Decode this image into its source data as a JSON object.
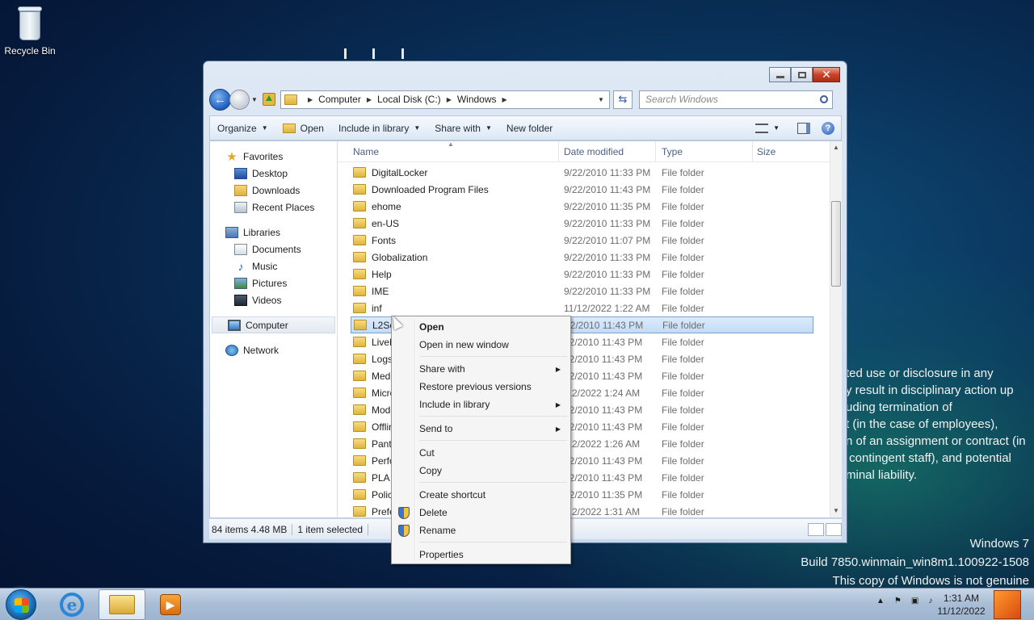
{
  "desktop": {
    "recycle_bin_label": "Recycle Bin",
    "legal_text": "ted use or disclosure in any\ny result in disciplinary action up\nuding termination of\nt (in the case of employees),\nn of an assignment or contract (in\n contingent staff), and potential\nminal liability.",
    "build_lines": [
      "Windows 7",
      "Build 7850.winmain_win8m1.100922-1508",
      "This copy of Windows is not genuine"
    ]
  },
  "window": {
    "address": [
      "Computer",
      "Local Disk (C:)",
      "Windows"
    ],
    "search_placeholder": "Search Windows",
    "toolbar": {
      "organize": "Organize",
      "open": "Open",
      "include_in_library": "Include in library",
      "share_with": "Share with",
      "new_folder": "New folder"
    },
    "nav": {
      "favorites": "Favorites",
      "favorites_items": [
        "Desktop",
        "Downloads",
        "Recent Places"
      ],
      "libraries": "Libraries",
      "library_items": [
        "Documents",
        "Music",
        "Pictures",
        "Videos"
      ],
      "computer": "Computer",
      "network": "Network"
    },
    "columns": [
      "Name",
      "Date modified",
      "Type",
      "Size"
    ],
    "files": [
      {
        "name": "DigitalLocker",
        "date": "9/22/2010 11:33 PM",
        "type": "File folder"
      },
      {
        "name": "Downloaded Program Files",
        "date": "9/22/2010 11:43 PM",
        "type": "File folder"
      },
      {
        "name": "ehome",
        "date": "9/22/2010 11:35 PM",
        "type": "File folder"
      },
      {
        "name": "en-US",
        "date": "9/22/2010 11:33 PM",
        "type": "File folder"
      },
      {
        "name": "Fonts",
        "date": "9/22/2010 11:07 PM",
        "type": "File folder"
      },
      {
        "name": "Globalization",
        "date": "9/22/2010 11:33 PM",
        "type": "File folder"
      },
      {
        "name": "Help",
        "date": "9/22/2010 11:33 PM",
        "type": "File folder"
      },
      {
        "name": "IME",
        "date": "9/22/2010 11:33 PM",
        "type": "File folder"
      },
      {
        "name": "inf",
        "date": "11/12/2022 1:22 AM",
        "type": "File folder"
      },
      {
        "name": "L2Sch",
        "date": "22/2010 11:43 PM",
        "type": "File folder"
      },
      {
        "name": "LiveK",
        "date": "22/2010 11:43 PM",
        "type": "File folder"
      },
      {
        "name": "Logs",
        "date": "22/2010 11:43 PM",
        "type": "File folder"
      },
      {
        "name": "Medi",
        "date": "22/2010 11:43 PM",
        "type": "File folder"
      },
      {
        "name": "Micro",
        "date": "/12/2022 1:24 AM",
        "type": "File folder"
      },
      {
        "name": "Mode",
        "date": "22/2010 11:43 PM",
        "type": "File folder"
      },
      {
        "name": "Offlin",
        "date": "22/2010 11:43 PM",
        "type": "File folder"
      },
      {
        "name": "Panth",
        "date": "/12/2022 1:26 AM",
        "type": "File folder"
      },
      {
        "name": "Perfo",
        "date": "22/2010 11:43 PM",
        "type": "File folder"
      },
      {
        "name": "PLA",
        "date": "22/2010 11:43 PM",
        "type": "File folder"
      },
      {
        "name": "Policy",
        "date": "22/2010 11:35 PM",
        "type": "File folder"
      },
      {
        "name": "Prefe",
        "date": "/12/2022 1:31 AM",
        "type": "File folder"
      }
    ],
    "selected_index": 9,
    "status": {
      "items": "84 items  4.48 MB",
      "selected": "1 item selected"
    }
  },
  "context_menu": {
    "open": "Open",
    "open_new_window": "Open in new window",
    "share_with": "Share with",
    "restore_previous": "Restore previous versions",
    "include_in_library": "Include in library",
    "send_to": "Send to",
    "cut": "Cut",
    "copy": "Copy",
    "create_shortcut": "Create shortcut",
    "delete": "Delete",
    "rename": "Rename",
    "properties": "Properties"
  },
  "taskbar": {
    "time": "1:31 AM",
    "date": "11/12/2022",
    "ie_glyph": "e"
  },
  "colors": {
    "selection": "#c2dcf7",
    "desktop": "#093058"
  }
}
